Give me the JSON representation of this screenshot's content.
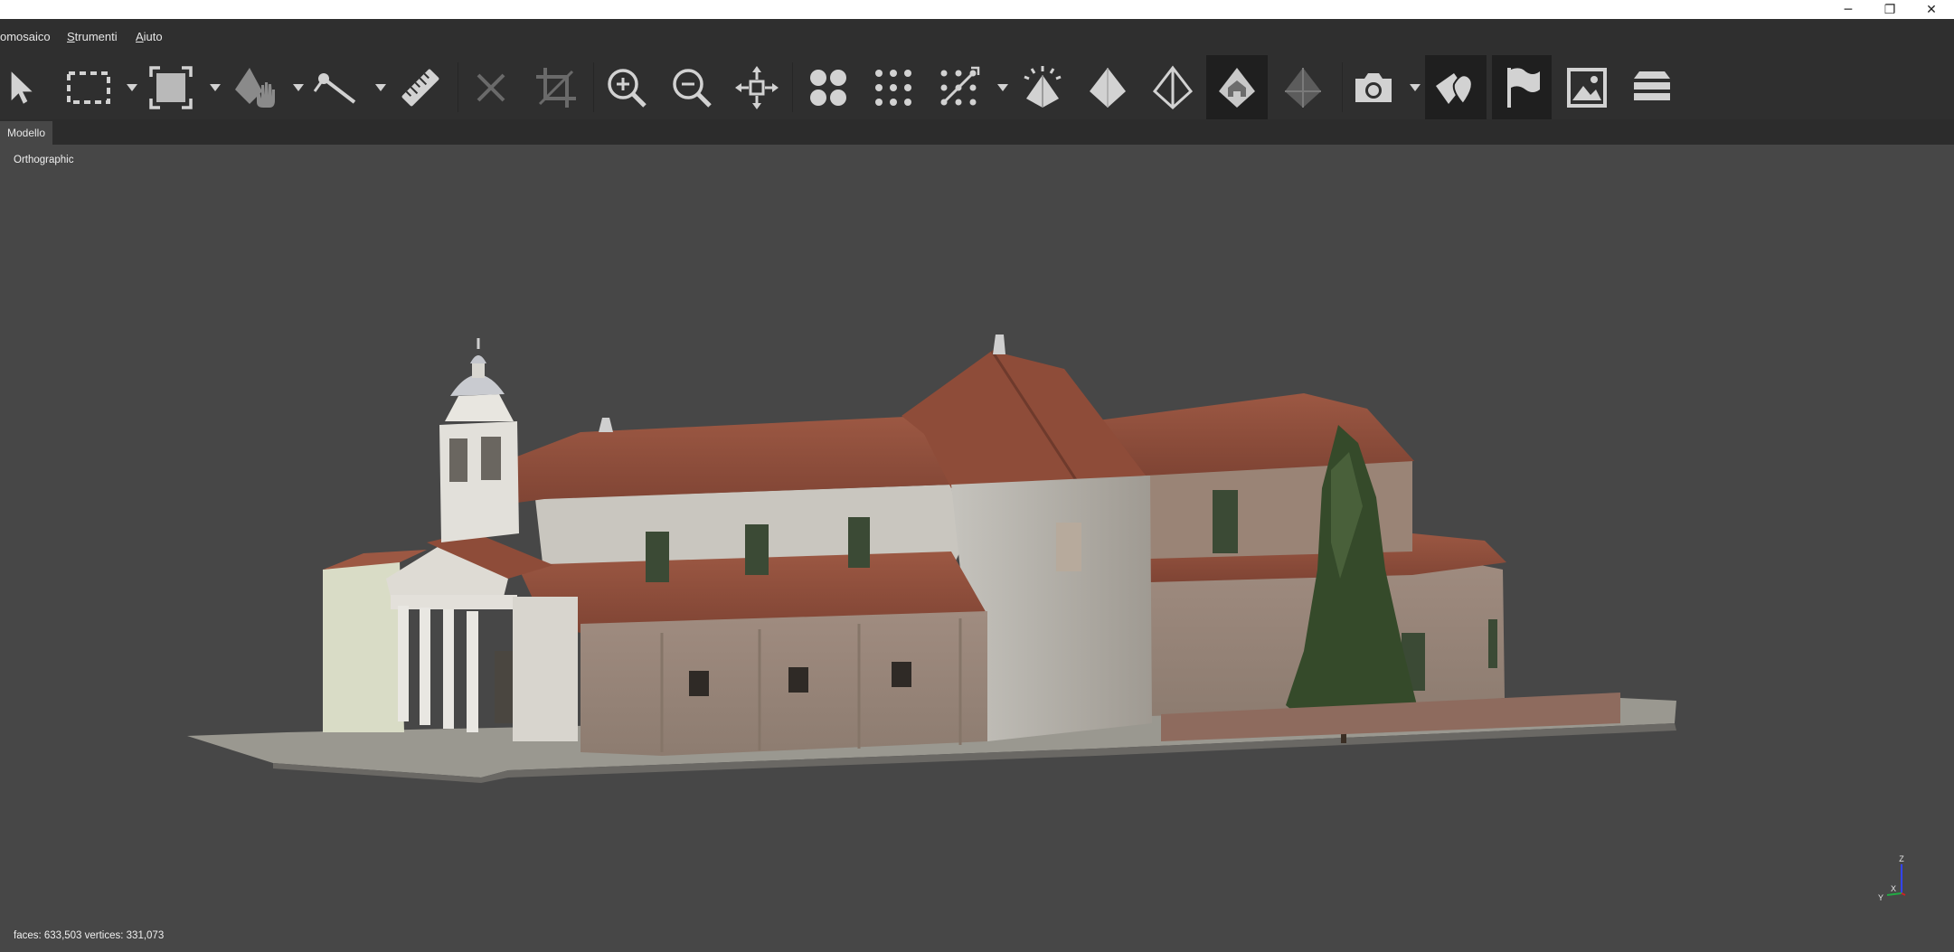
{
  "window": {
    "minimize_glyph": "─",
    "restore_glyph": "❐",
    "close_glyph": "✕"
  },
  "menu": [
    {
      "label": "omosaico",
      "accel": ""
    },
    {
      "label": "trumenti",
      "accel": "S"
    },
    {
      "label": "iuto",
      "accel": "A"
    }
  ],
  "toolbar": {
    "tools": [
      {
        "icon": "select-arrow-icon"
      },
      {
        "icon": "rectangle-select-icon"
      },
      {
        "icon": "fill-select-icon"
      },
      {
        "icon": "polygon-hand-icon"
      },
      {
        "icon": "measure-line-icon"
      },
      {
        "icon": "ruler-icon"
      },
      {
        "icon": "delete-x-icon"
      },
      {
        "icon": "crop-icon"
      },
      {
        "icon": "zoom-in-icon"
      },
      {
        "icon": "zoom-out-icon"
      },
      {
        "icon": "fit-view-icon"
      },
      {
        "icon": "cameras-icon"
      },
      {
        "icon": "points-grid-icon"
      },
      {
        "icon": "dense-points-icon"
      },
      {
        "icon": "tiepoints-icon"
      },
      {
        "icon": "solid-model-icon"
      },
      {
        "icon": "wireframe-model-icon"
      },
      {
        "icon": "textured-model-icon"
      },
      {
        "icon": "shaded-model-icon"
      },
      {
        "icon": "camera-icon"
      },
      {
        "icon": "show-shapes-icon"
      },
      {
        "icon": "flag-markers-icon"
      },
      {
        "icon": "image-icon"
      },
      {
        "icon": "layers-icon"
      }
    ]
  },
  "tabs": [
    {
      "label": "Modello"
    }
  ],
  "viewport": {
    "projection_label": "Orthographic",
    "status": "faces: 633,503 vertices: 331,073",
    "axes": {
      "z": "Z",
      "y": "Y",
      "x": "X"
    }
  },
  "colors": {
    "background": "#474747",
    "chrome": "#2f2f2f",
    "icon": "#d2d2d2",
    "roof": "#93503c",
    "brick": "#9d8a7d",
    "plaster": "#d6d4cd",
    "tree": "#354a2a",
    "axis_x": "#cc2222",
    "axis_y": "#22aa44",
    "axis_z": "#3344ff"
  }
}
